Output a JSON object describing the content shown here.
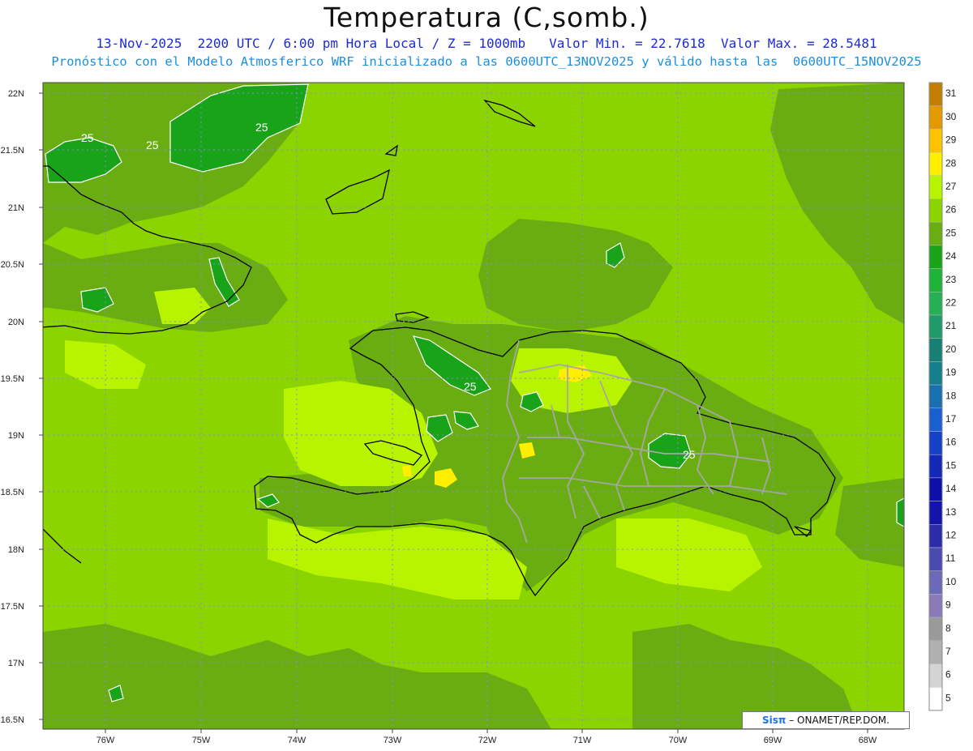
{
  "title": "Temperatura (C,somb.)",
  "subtitle_line1": "13-Nov-2025  2200 UTC / 6:00 pm Hora Local / Z = 1000mb   Valor Min. = 22.7618  Valor Max. = 28.5481",
  "subtitle_line2": "Pronóstico con el Modelo Atmosferico WRF inicializado a las 0600UTC_13NOV2025 y válido hasta las  0600UTC_15NOV2025",
  "credit": {
    "brand": "Sisπ",
    "text": " – ONAMET/REP.DOM."
  },
  "lat_labels": [
    "22N",
    "21.5N",
    "21N",
    "20.5N",
    "20N",
    "19.5N",
    "19N",
    "18.5N",
    "18N",
    "17.5N",
    "17N",
    "16.5N"
  ],
  "lon_labels": [
    "76W",
    "75W",
    "74W",
    "73W",
    "72W",
    "71W",
    "70W",
    "69W",
    "68W"
  ],
  "contour_labels": [
    "25",
    "25",
    "25",
    "25",
    "25"
  ],
  "colorbar": {
    "levels": [
      "31",
      "30",
      "29",
      "28",
      "27",
      "26",
      "25",
      "24",
      "23",
      "22",
      "21",
      "20",
      "19",
      "18",
      "17",
      "16",
      "15",
      "14",
      "13",
      "12",
      "11",
      "10",
      "9",
      "8",
      "7",
      "6",
      "5"
    ],
    "colors": [
      "#c47f00",
      "#e39a00",
      "#ffc400",
      "#ffee00",
      "#b8f400",
      "#8cd400",
      "#6aad12",
      "#19a319",
      "#1fb33a",
      "#25b056",
      "#1f9a68",
      "#177f73",
      "#147f8c",
      "#1a6fb0",
      "#1a5fd0",
      "#1640c8",
      "#1428b8",
      "#0e0ea8",
      "#1414a8",
      "#2c2ca8",
      "#4a4ab0",
      "#6a6ab8",
      "#8a7ab8",
      "#9a9a9a",
      "#b0b0b0",
      "#d4d4d4",
      "#ffffff"
    ]
  },
  "colors": {
    "ocean": "#8cd400",
    "warm_patch": "#b8f400",
    "hot_spot": "#ffee00",
    "cool_patch": "#6aad12",
    "cold_patch": "#19a319",
    "coast": "#000000",
    "provinces": "#a6a6a6",
    "grid": "#8a8adc"
  }
}
